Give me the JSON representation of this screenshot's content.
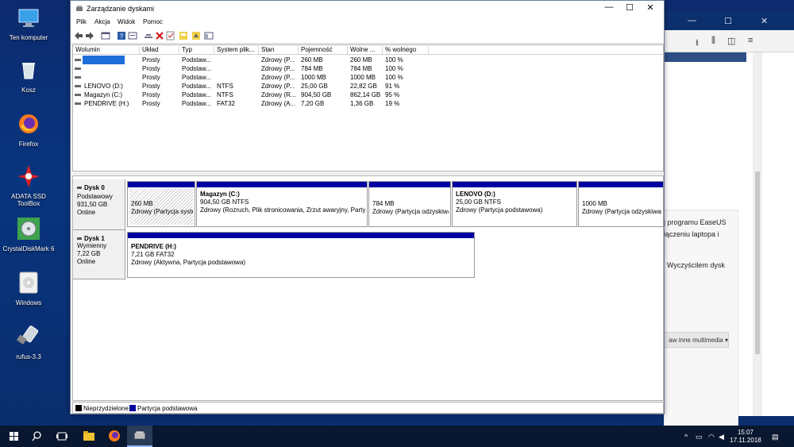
{
  "desktop": {
    "icons": [
      {
        "label": "Ten komputer"
      },
      {
        "label": "Kosz"
      },
      {
        "label": "Firefox"
      },
      {
        "label": "ADATA SSD ToolBox"
      },
      {
        "label": "CrystalDiskMark 6"
      },
      {
        "label": "Windows"
      },
      {
        "label": "rufus-3.3"
      }
    ]
  },
  "browser": {
    "text_line1": "j programu EaseUS",
    "text_line2": "łączeniu laptopa i",
    "text_line3": "Wyczyścilem dysk",
    "more_button": "aw inne multimedia ▾"
  },
  "window": {
    "title": "Zarządzanie dyskami",
    "controls": {
      "minimize": "—",
      "maximize": "☐",
      "close": "✕"
    },
    "menu": [
      "Plik",
      "Akcja",
      "Widok",
      "Pomoc"
    ]
  },
  "volume_table": {
    "headers": [
      "Wolumin",
      "Układ",
      "Typ",
      "System plik...",
      "Stan",
      "Pojemność",
      "Wolne ...",
      "% wolnego"
    ],
    "rows": [
      {
        "name": "",
        "layout": "Prosty",
        "type": "Podstaw...",
        "fs": "",
        "status": "Zdrowy (P...",
        "capacity": "260 MB",
        "free": "260 MB",
        "pct": "100 %"
      },
      {
        "name": "",
        "layout": "Prosty",
        "type": "Podstaw...",
        "fs": "",
        "status": "Zdrowy (P...",
        "capacity": "784 MB",
        "free": "784 MB",
        "pct": "100 %"
      },
      {
        "name": "",
        "layout": "Prosty",
        "type": "Podstaw...",
        "fs": "",
        "status": "Zdrowy (P...",
        "capacity": "1000 MB",
        "free": "1000 MB",
        "pct": "100 %"
      },
      {
        "name": "LENOVO (D:)",
        "layout": "Prosty",
        "type": "Podstaw...",
        "fs": "NTFS",
        "status": "Zdrowy (P...",
        "capacity": "25,00 GB",
        "free": "22,82 GB",
        "pct": "91 %"
      },
      {
        "name": "Magazyn (C:)",
        "layout": "Prosty",
        "type": "Podstaw...",
        "fs": "NTFS",
        "status": "Zdrowy (R...",
        "capacity": "904,50 GB",
        "free": "862,14 GB",
        "pct": "95 %"
      },
      {
        "name": "PENDRIVE (H:)",
        "layout": "Prosty",
        "type": "Podstaw...",
        "fs": "FAT32",
        "status": "Zdrowy (A...",
        "capacity": "7,20 GB",
        "free": "1,36 GB",
        "pct": "19 %"
      }
    ]
  },
  "disks": [
    {
      "name": "Dysk 0",
      "kind": "Podstawowy",
      "size": "931,50 GB",
      "state": "Online",
      "partitions": [
        {
          "title": "",
          "size": "260 MB",
          "desc": "Zdrowy (Partycja systemowa EFI)"
        },
        {
          "title": "Magazyn  (C:)",
          "size": "904,50 GB NTFS",
          "desc": "Zdrowy (Rozruch, Plik stronicowania, Zrzut awaryjny, Partycja podstawowa)"
        },
        {
          "title": "",
          "size": "784 MB",
          "desc": "Zdrowy (Partycja odzyskiwania)"
        },
        {
          "title": "LENOVO  (D:)",
          "size": "25,00 GB NTFS",
          "desc": "Zdrowy (Partycja podstawowa)"
        },
        {
          "title": "",
          "size": "1000 MB",
          "desc": "Zdrowy (Partycja odzyskiwania)"
        }
      ]
    },
    {
      "name": "Dysk 1",
      "kind": "Wymienny",
      "size": "7,22 GB",
      "state": "Online",
      "partitions": [
        {
          "title": "PENDRIVE  (H:)",
          "size": "7,21 GB FAT32",
          "desc": "Zdrowy (Aktywna, Partycja podstawowa)"
        }
      ]
    }
  ],
  "legend": {
    "unallocated": "Nieprzydzielone",
    "primary": "Partycja podstawowa",
    "colors": {
      "unallocated": "#000000",
      "primary": "#0000a0"
    }
  },
  "taskbar": {
    "time": "15:07",
    "date": "17.11.2018"
  }
}
